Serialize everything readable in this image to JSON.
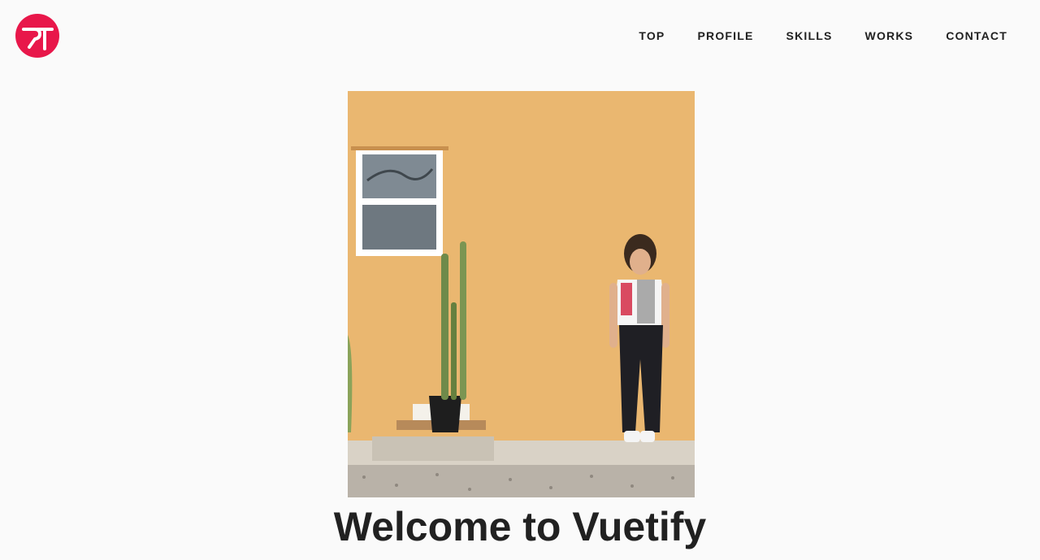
{
  "brand": {
    "logo_icon": "rt-monogram-icon",
    "accent_color": "#e8174a"
  },
  "nav": {
    "items": [
      {
        "label": "TOP"
      },
      {
        "label": "PROFILE"
      },
      {
        "label": "SKILLS"
      },
      {
        "label": "WORKS"
      },
      {
        "label": "CONTACT"
      }
    ]
  },
  "hero": {
    "image_subject": "portrait-photo",
    "title": "Welcome to Vuetify"
  },
  "colors": {
    "background": "#fafafa",
    "text": "#212121",
    "wall": "#e9b56c"
  }
}
